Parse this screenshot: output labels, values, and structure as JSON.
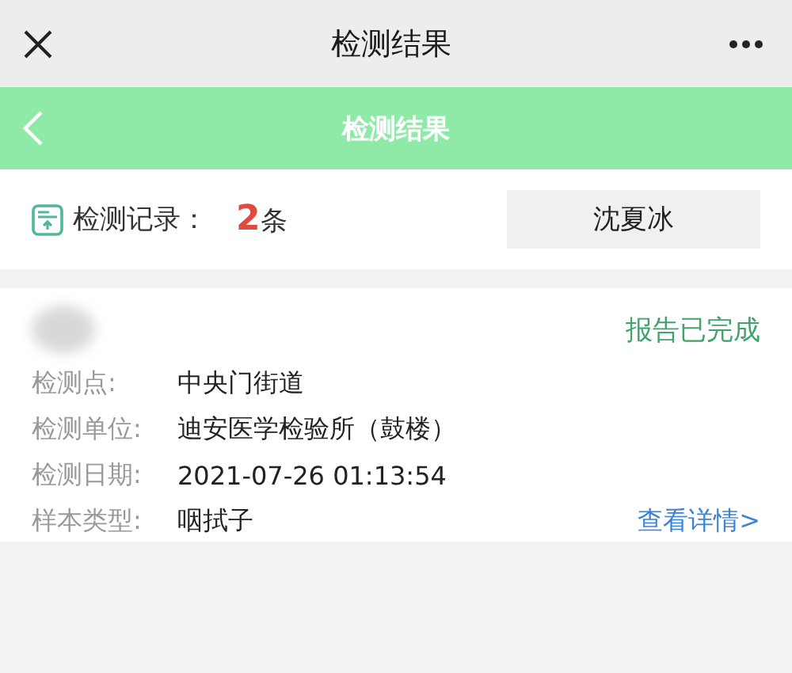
{
  "window": {
    "title": "检测结果"
  },
  "header": {
    "title": "检测结果"
  },
  "records": {
    "label": "检测记录：",
    "count": "2",
    "unit": "条",
    "person": "沈夏冰"
  },
  "card": {
    "status": "报告已完成",
    "fields": [
      {
        "label": "检测点:",
        "value": "中央门街道"
      },
      {
        "label": "检测单位:",
        "value": "迪安医学检验所（鼓楼）"
      },
      {
        "label": "检测日期:",
        "value": "2021-07-26 01:13:54"
      },
      {
        "label": "样本类型:",
        "value": "咽拭子"
      }
    ],
    "link": "查看详情>"
  }
}
